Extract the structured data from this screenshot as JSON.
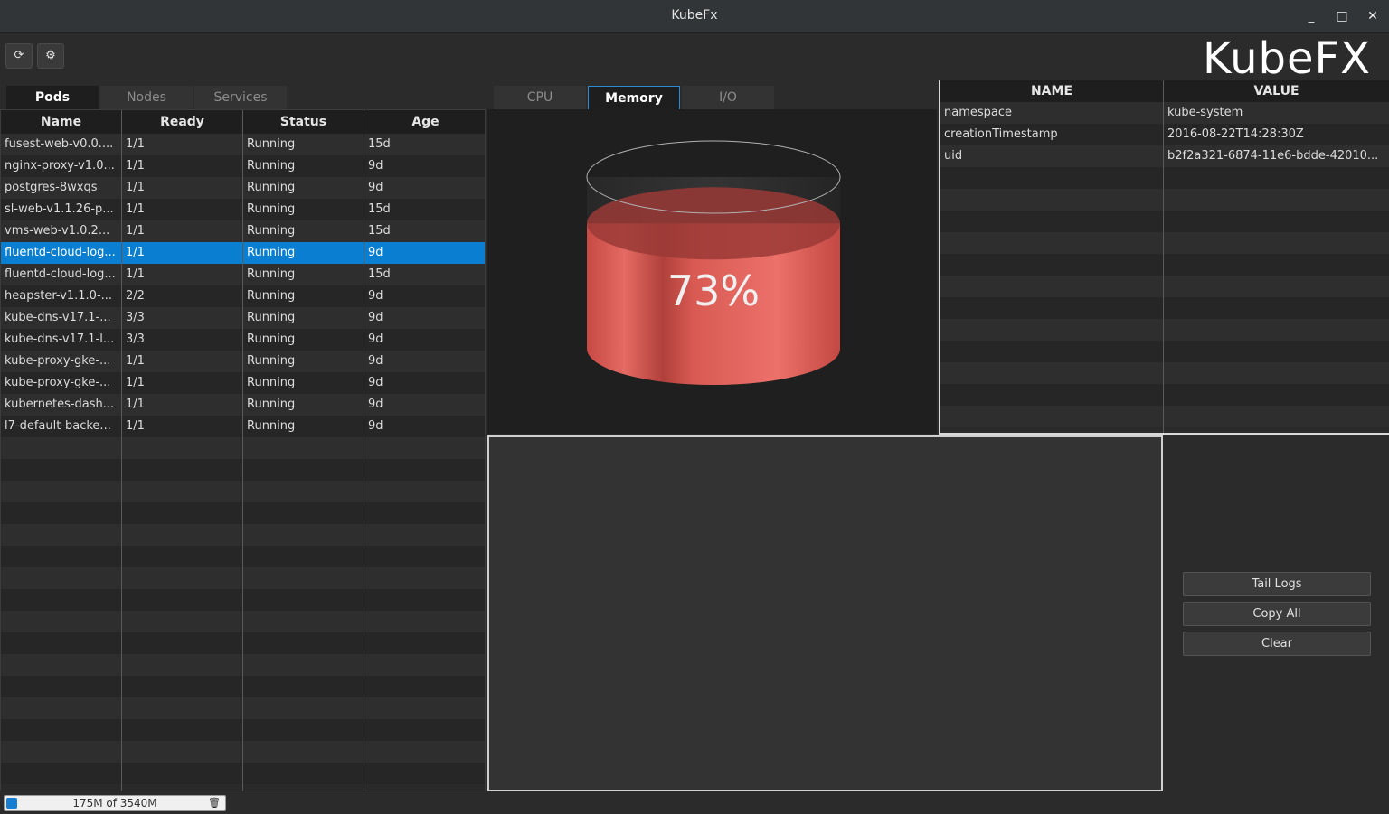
{
  "window": {
    "title": "KubeFx",
    "minimize": "_",
    "maximize": "□",
    "close": "✕"
  },
  "toolbar": {
    "refresh_icon": "⟳",
    "settings_icon": "⚙",
    "logo": "KubeFX"
  },
  "left_tabs": [
    "Pods",
    "Nodes",
    "Services"
  ],
  "pods_table": {
    "columns": [
      "Name",
      "Ready",
      "Status",
      "Age"
    ],
    "rows": [
      [
        "fusest-web-v0.0....",
        "1/1",
        "Running",
        "15d"
      ],
      [
        "nginx-proxy-v1.0...",
        "1/1",
        "Running",
        "9d"
      ],
      [
        "postgres-8wxqs",
        "1/1",
        "Running",
        "9d"
      ],
      [
        "sl-web-v1.1.26-p...",
        "1/1",
        "Running",
        "15d"
      ],
      [
        "vms-web-v1.0.2...",
        "1/1",
        "Running",
        "15d"
      ],
      [
        "fluentd-cloud-log...",
        "1/1",
        "Running",
        "9d"
      ],
      [
        "fluentd-cloud-log...",
        "1/1",
        "Running",
        "15d"
      ],
      [
        "heapster-v1.1.0-...",
        "2/2",
        "Running",
        "9d"
      ],
      [
        "kube-dns-v17.1-...",
        "3/3",
        "Running",
        "9d"
      ],
      [
        "kube-dns-v17.1-l...",
        "3/3",
        "Running",
        "9d"
      ],
      [
        "kube-proxy-gke-...",
        "1/1",
        "Running",
        "9d"
      ],
      [
        "kube-proxy-gke-...",
        "1/1",
        "Running",
        "9d"
      ],
      [
        "kubernetes-dash...",
        "1/1",
        "Running",
        "9d"
      ],
      [
        "l7-default-backe...",
        "1/1",
        "Running",
        "9d"
      ]
    ],
    "selected_index": 5
  },
  "chart_tabs": [
    "CPU",
    "Memory",
    "I/O"
  ],
  "chart_data": {
    "type": "gauge",
    "label": "73%",
    "value": 73,
    "max": 100,
    "fill_color": "#e2605a"
  },
  "props_table": {
    "columns": [
      "NAME",
      "VALUE"
    ],
    "rows": [
      [
        "namespace",
        "kube-system"
      ],
      [
        "creationTimestamp",
        "2016-08-22T14:28:30Z"
      ],
      [
        "uid",
        "b2f2a321-6874-11e6-bdde-42010..."
      ]
    ]
  },
  "actions": {
    "tail_logs": "Tail Logs",
    "copy_all": "Copy All",
    "clear": "Clear"
  },
  "statusbar": {
    "memory_text": "175M of 3540M",
    "memory_used_fraction": 0.049,
    "trash_icon": "🗑"
  }
}
